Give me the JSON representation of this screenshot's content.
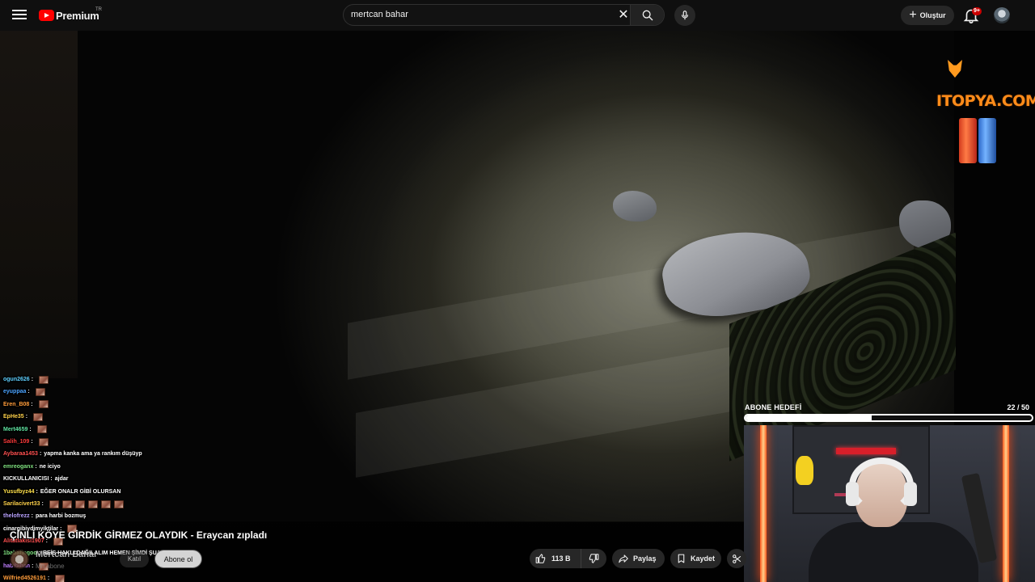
{
  "header": {
    "logo_text": "Premium",
    "logo_country": "TR",
    "search_value": "mertcan bahar",
    "create_label": "Oluştur",
    "notification_badge": "9+"
  },
  "video": {
    "title": "ÇİNLİ KÖYE GİRDİK GİRMEZ OLAYDIK - Eraycan zıpladı",
    "channel_name": "Mertcan Bahar",
    "subscriber_count": "Mn abone",
    "join_label": "Katıl",
    "subscribe_label": "Abone ol",
    "like_count": "113 B",
    "share_label": "Paylaş",
    "save_label": "Kaydet"
  },
  "overlay": {
    "sponsor_text": "ITOPYA.COM",
    "goal_label": "ABONE HEDEFİ",
    "goal_current": 22,
    "goal_total": 50,
    "goal_count_text": "22  / 50",
    "goal_fill_fraction": 0.44
  },
  "chat": [
    {
      "user": "ogun2626",
      "msg": "",
      "emotes": 1,
      "color": "#5fd0ff"
    },
    {
      "user": "eyuppaa",
      "msg": "",
      "emotes": 1,
      "color": "#4aa3ff"
    },
    {
      "user": "Eren_B08",
      "msg": "",
      "emotes": 1,
      "color": "#ff9c3a"
    },
    {
      "user": "EpHe35",
      "msg": "",
      "emotes": 1,
      "color": "#ffd24a"
    },
    {
      "user": "Mert4659",
      "msg": "",
      "emotes": 1,
      "color": "#5fe3a0"
    },
    {
      "user": "Salih_109",
      "msg": "",
      "emotes": 1,
      "color": "#ff3b3b"
    },
    {
      "user": "Aybaraa1453",
      "msg": "yapma kanka ama ya rankım düşüyp",
      "emotes": 0,
      "color": "#ff5050"
    },
    {
      "user": "emreoganx",
      "msg": "ne iciyo",
      "emotes": 0,
      "color": "#7fe07f"
    },
    {
      "user": "KICKULLANICISI",
      "msg": "ajdar",
      "emotes": 0,
      "color": "#ffffff"
    },
    {
      "user": "Yusufbyz44",
      "msg": "EĞER ONALR GİBİ OLURSAN",
      "emotes": 0,
      "color": "#ffe04a"
    },
    {
      "user": "Sarilacivert33",
      "msg": "",
      "emotes": 6,
      "color": "#ffd24a"
    },
    {
      "user": "thelofrezz",
      "msg": "para harbi bozmuş",
      "emotes": 0,
      "color": "#b9a2ff"
    },
    {
      "user": "cinargibiydimyiktilar",
      "msg": "",
      "emotes": 1,
      "color": "#ffffff"
    },
    {
      "user": "Alitatlakisi1907",
      "msg": "",
      "emotes": 1,
      "color": "#ff5050"
    },
    {
      "user": "1babafingoo",
      "msg": "REİS HAKLI DAĞILALIM HEMEN ŞİMDİ ŞUAN HEMEN",
      "emotes": 0,
      "color": "#7fe07f"
    },
    {
      "user": "habibihan",
      "msg": "",
      "emotes": 1,
      "color": "#c07fff"
    },
    {
      "user": "Wilfried4526191",
      "msg": "",
      "emotes": 1,
      "color": "#ff9c3a"
    }
  ]
}
